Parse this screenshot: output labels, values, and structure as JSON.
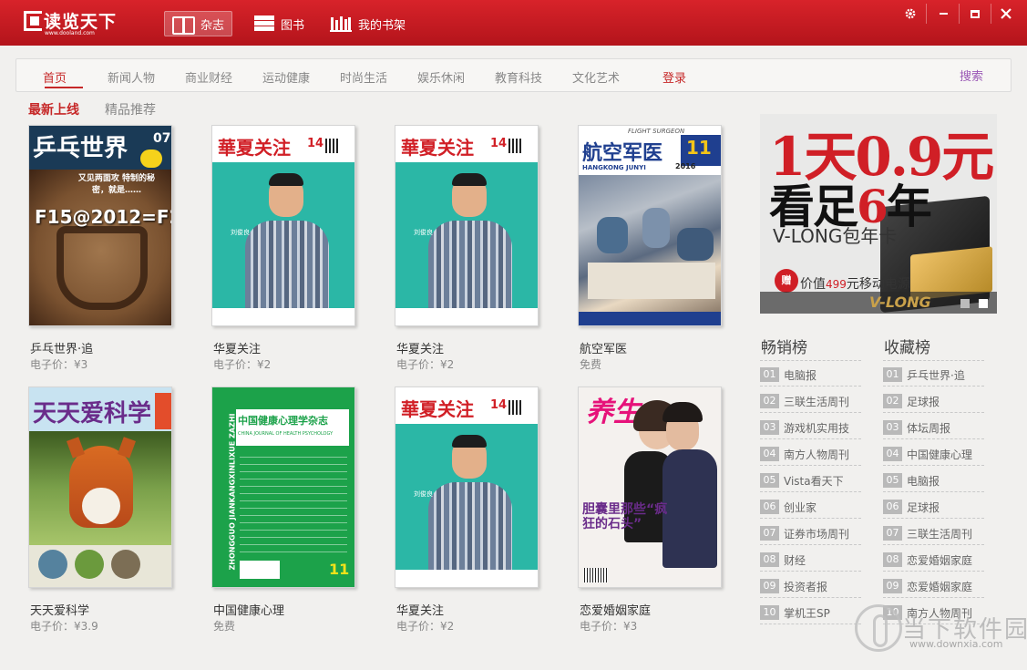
{
  "app": {
    "name": "读览天下",
    "url": "www.dooland.com"
  },
  "topnav": [
    {
      "label": "杂志",
      "icon": "magazine-icon"
    },
    {
      "label": "图书",
      "icon": "books-icon"
    },
    {
      "label": "我的书架",
      "icon": "bookshelf-icon"
    }
  ],
  "window_controls": {
    "settings": "settings-gear-icon",
    "minimize": "minimize-icon",
    "maximize": "maximize-icon",
    "close": "close-icon"
  },
  "categories": {
    "items": [
      "首页",
      "新闻人物",
      "商业财经",
      "运动健康",
      "时尚生活",
      "娱乐休闲",
      "教育科技",
      "文化艺术"
    ],
    "active": "首页",
    "login": "登录",
    "search": "搜索"
  },
  "subtabs": {
    "latest": "最新上线",
    "featured": "精品推荐"
  },
  "magazines": [
    {
      "title": "乒乓世界·追",
      "price": "电子价：¥3"
    },
    {
      "title": "华夏关注",
      "price": "电子价：¥2"
    },
    {
      "title": "华夏关注",
      "price": "电子价：¥2"
    },
    {
      "title": "航空军医",
      "price": "免费"
    },
    {
      "title": "天天爱科学",
      "price": "电子价：¥3.9"
    },
    {
      "title": "中国健康心理",
      "price": "免费"
    },
    {
      "title": "华夏关注",
      "price": "电子价：¥2"
    },
    {
      "title": "恋爱婚姻家庭",
      "price": "电子价：¥3"
    }
  ],
  "covers": {
    "pingpang": {
      "title": "乒乓世界",
      "issue": "07",
      "text": "F15@2012=F22",
      "sub": "又见两面攻 特制的秘密，就是……"
    },
    "huaxia": {
      "title": "華夏关注",
      "issue": "14",
      "caption": "刘俊良"
    },
    "hangkong": {
      "title": "航空军医",
      "en": "FLIGHT SURGEON",
      "pinyin": "HANGKONG JUNYI",
      "issue": "11",
      "year": "2016"
    },
    "kexue": {
      "title": "天天爱科学"
    },
    "xinli": {
      "title": "中国健康心理学杂志",
      "en": "CHINA JOURNAL OF HEALTH PSYCHOLOGY",
      "pinyin": "ZHONGGUO JIANKANGXINLIXUE ZAZHI",
      "issue": "11"
    },
    "yangsheng": {
      "title": "养生",
      "headline": "胆囊里那些“疯狂的石头”"
    }
  },
  "ad": {
    "line1a": "1天",
    "line1b": "0.9元",
    "line2a": "看足",
    "line2b": "6",
    "line2c": "年",
    "line3": "V-LONG包年卡",
    "gift": "赠",
    "line4a": "价值",
    "line4b": "499",
    "line4c": "元移动电源",
    "card_text": "V-LONG",
    "slides": 2,
    "active_slide": 2
  },
  "bestsellers": {
    "title": "畅销榜",
    "items": [
      {
        "num": "01",
        "name": "电脑报"
      },
      {
        "num": "02",
        "name": "三联生活周刊"
      },
      {
        "num": "03",
        "name": "游戏机实用技"
      },
      {
        "num": "04",
        "name": "南方人物周刊"
      },
      {
        "num": "05",
        "name": "Vista看天下"
      },
      {
        "num": "06",
        "name": "创业家"
      },
      {
        "num": "07",
        "name": "证券市场周刊"
      },
      {
        "num": "08",
        "name": "财经"
      },
      {
        "num": "09",
        "name": "投资者报"
      },
      {
        "num": "10",
        "name": "掌机王SP"
      }
    ]
  },
  "favorites": {
    "title": "收藏榜",
    "items": [
      {
        "num": "01",
        "name": "乒乓世界·追"
      },
      {
        "num": "02",
        "name": "足球报"
      },
      {
        "num": "03",
        "name": "体坛周报"
      },
      {
        "num": "04",
        "name": "中国健康心理"
      },
      {
        "num": "05",
        "name": "电脑报"
      },
      {
        "num": "06",
        "name": "足球报"
      },
      {
        "num": "07",
        "name": "三联生活周刊"
      },
      {
        "num": "08",
        "name": "恋爱婚姻家庭"
      },
      {
        "num": "09",
        "name": "恋爱婚姻家庭"
      },
      {
        "num": "10",
        "name": "南方人物周刊"
      }
    ]
  },
  "watermark": {
    "text": "当下软件园",
    "url": "www.downxia.com"
  }
}
